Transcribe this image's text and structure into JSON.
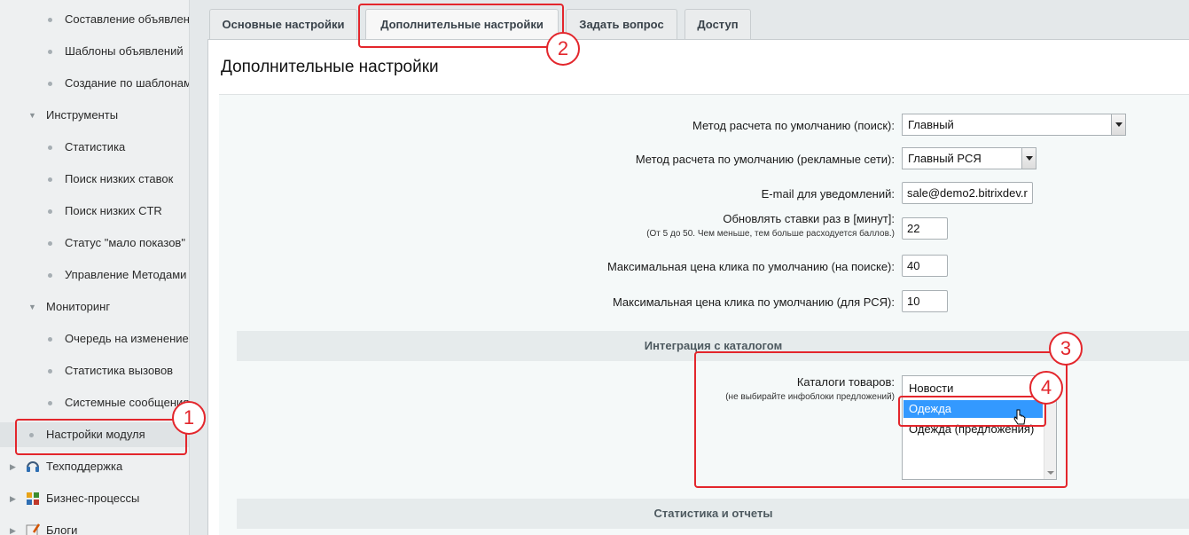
{
  "sidebar": {
    "items": [
      {
        "label": "Составление объявлений",
        "level": 2
      },
      {
        "label": "Шаблоны объявлений",
        "level": 2
      },
      {
        "label": "Создание по шаблонам",
        "level": 2
      },
      {
        "label": "Инструменты",
        "level": 1,
        "expanded": true
      },
      {
        "label": "Статистика",
        "level": 2
      },
      {
        "label": "Поиск низких ставок",
        "level": 2
      },
      {
        "label": "Поиск низких CTR",
        "level": 2
      },
      {
        "label": "Статус \"мало показов\"",
        "level": 2
      },
      {
        "label": "Управление Методами",
        "level": 2
      },
      {
        "label": "Мониторинг",
        "level": 1,
        "expanded": true
      },
      {
        "label": "Очередь на изменение",
        "level": 2
      },
      {
        "label": "Статистика вызовов",
        "level": 2
      },
      {
        "label": "Системные сообщения",
        "level": 2
      },
      {
        "label": "Настройки модуля",
        "level": 1,
        "active": true
      },
      {
        "label": "Техподдержка",
        "level": 0,
        "icon": "headset-icon"
      },
      {
        "label": "Бизнес-процессы",
        "level": 0,
        "icon": "business-process-icon"
      },
      {
        "label": "Блоги",
        "level": 0,
        "icon": "blog-icon"
      }
    ]
  },
  "tabs": [
    {
      "label": "Основные настройки",
      "active": false
    },
    {
      "label": "Дополнительные настройки",
      "active": true
    },
    {
      "label": "Задать вопрос",
      "active": false
    },
    {
      "label": "Доступ",
      "active": false
    }
  ],
  "panel": {
    "title": "Дополнительные настройки"
  },
  "form": {
    "search_method_label": "Метод расчета по умолчанию (поиск):",
    "search_method_value": "Главный",
    "ad_method_label": "Метод расчета по умолчанию (рекламные сети):",
    "ad_method_value": "Главный РСЯ",
    "email_label": "E-mail для уведомлений:",
    "email_value": "sale@demo2.bitrixdev.r",
    "update_label": "Обновлять ставки раз в [минут]:",
    "update_hint": "(От 5 до 50. Чем меньше, тем больше расходуется баллов.)",
    "update_value": "22",
    "max_search_label": "Максимальная цена клика по умолчанию (на поиске):",
    "max_search_value": "40",
    "max_rsya_label": "Максимальная цена клика по умолчанию (для РСЯ):",
    "max_rsya_value": "10"
  },
  "catalog_section": {
    "title": "Интеграция с каталогом",
    "catalogs_label": "Каталоги товаров:",
    "catalogs_hint": "(не выбирайте инфоблоки предложений)",
    "options": [
      {
        "label": "Новости",
        "selected": false
      },
      {
        "label": "Одежда",
        "selected": true
      },
      {
        "label": "Одежда (предложения)",
        "selected": false
      }
    ]
  },
  "stats_section": {
    "title": "Статистика и отчеты"
  },
  "annotations": [
    "1",
    "2",
    "3",
    "4"
  ],
  "colors": {
    "annotation": "#e3262c",
    "selection": "#3399ff"
  }
}
